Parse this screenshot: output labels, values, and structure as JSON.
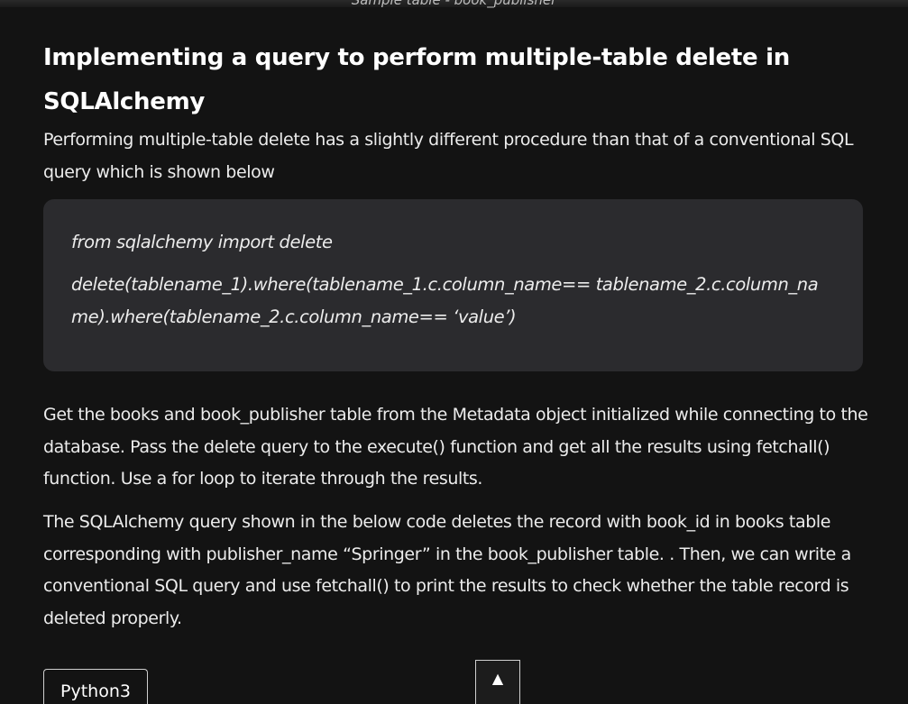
{
  "caption": "Sample table - book_publisher",
  "article": {
    "heading": "Implementing a query to perform multiple-table delete in SQLAlchemy",
    "intro": "Performing multiple-table delete has a slightly different procedure than that of a conventional SQL query which is  shown below",
    "code_lines": [
      "from sqlalchemy import delete",
      "delete(tablename_1).where(tablename_1.c.column_name== tablename_2.c.column_na",
      "me).where(tablename_2.c.column_name== ‘value’)"
    ],
    "paragraphs": [
      "Get the books and book_publisher table from the Metadata object initialized while connecting to the database. Pass the delete query to the execute() function and get all the results using fetchall() function. Use a for loop to iterate through the results.",
      "The SQLAlchemy query shown in the below code deletes the record with book_id in books table corresponding with publisher_name “Springer” in the book_publisher table. . Then, we can write a conventional SQL query and use fetchall() to print the results to check whether the table record is deleted properly."
    ],
    "code_tab_label": "Python3"
  },
  "scroll_top": {
    "icon": "triangle-up-icon",
    "glyph": "▲"
  }
}
